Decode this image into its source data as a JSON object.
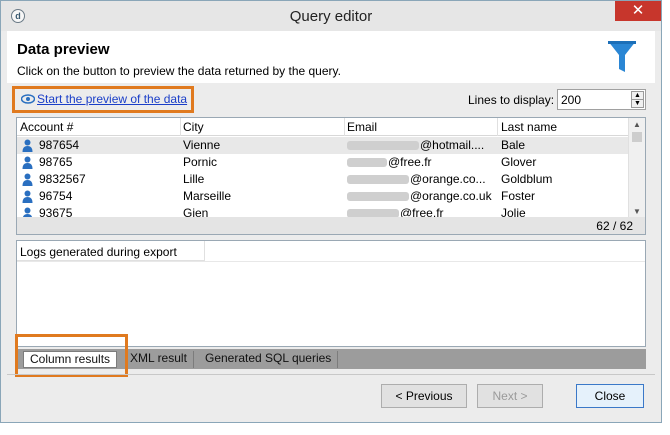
{
  "window": {
    "title": "Query editor",
    "app_icon_glyph": "d",
    "close_glyph": "✕"
  },
  "header": {
    "title": "Data preview",
    "subtitle": "Click on the button to preview the data returned by the query.",
    "icon": "funnel-icon",
    "accent": "#2a86d4"
  },
  "preview": {
    "link_label": "Start the preview of the data",
    "icon": "eye-icon",
    "highlight_color": "#e07a1f"
  },
  "lines": {
    "label": "Lines to display:",
    "value": "200"
  },
  "grid": {
    "columns": [
      "Account #",
      "City",
      "Email",
      "Last name"
    ],
    "rows": [
      {
        "account": "987654",
        "city": "Vienne",
        "email": "@hotmail....",
        "last_name": "Bale"
      },
      {
        "account": "98765",
        "city": "Pornic",
        "email": "@free.fr",
        "last_name": "Glover"
      },
      {
        "account": "9832567",
        "city": "Lille",
        "email": "@orange.co...",
        "last_name": "Goldblum"
      },
      {
        "account": "96754",
        "city": "Marseille",
        "email": "@orange.co.uk",
        "last_name": "Foster"
      },
      {
        "account": "93675",
        "city": "Gien",
        "email": "@free.fr",
        "last_name": "Jolie"
      }
    ],
    "count": "62 / 62"
  },
  "logs": {
    "label": "Logs generated during export"
  },
  "tabs": [
    "Column results",
    "XML result",
    "Generated SQL queries"
  ],
  "buttons": {
    "previous": "< Previous",
    "next": "Next >",
    "close": "Close"
  }
}
